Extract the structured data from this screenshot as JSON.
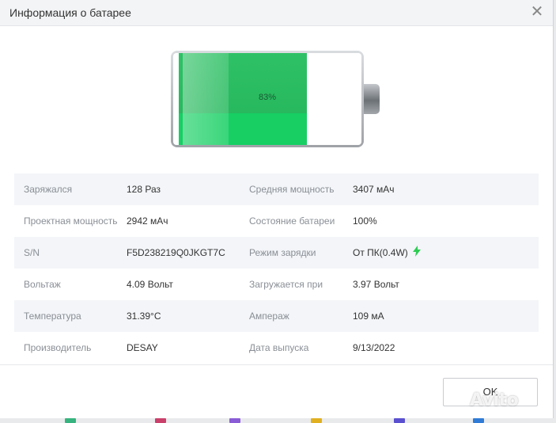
{
  "dialog": {
    "title": "Информация о батарее",
    "close_symbol": "✕"
  },
  "battery": {
    "percent_label": "83%",
    "level": 0.83,
    "fill_color": "#1fc45e"
  },
  "info_rows": [
    {
      "l1": "Заряжался",
      "v1": "128 Раз",
      "l2": "Средняя мощность",
      "v2": "3407 мАч"
    },
    {
      "l1": "Проектная мощность",
      "v1": "2942 мАч",
      "l2": "Состояние батареи",
      "v2": "100%"
    },
    {
      "l1": "S/N",
      "v1": "F5D238219Q0JKGT7C",
      "l2": "Режим зарядки",
      "v2": "От ПК(0.4W)"
    },
    {
      "l1": "Вольтаж",
      "v1": "4.09 Вольт",
      "l2": "Загружается при",
      "v2": "3.97 Вольт"
    },
    {
      "l1": "Температура",
      "v1": "31.39°C",
      "l2": "Ампераж",
      "v2": "109 мА"
    },
    {
      "l1": "Производитель",
      "v1": "DESAY",
      "l2": "Дата выпуска",
      "v2": "9/13/2022"
    }
  ],
  "footer": {
    "ok_label": "OK"
  },
  "watermark": {
    "text": "Avito"
  },
  "colors": {
    "accent_green": "#2ecc54",
    "label_gray": "#8a8f96"
  }
}
